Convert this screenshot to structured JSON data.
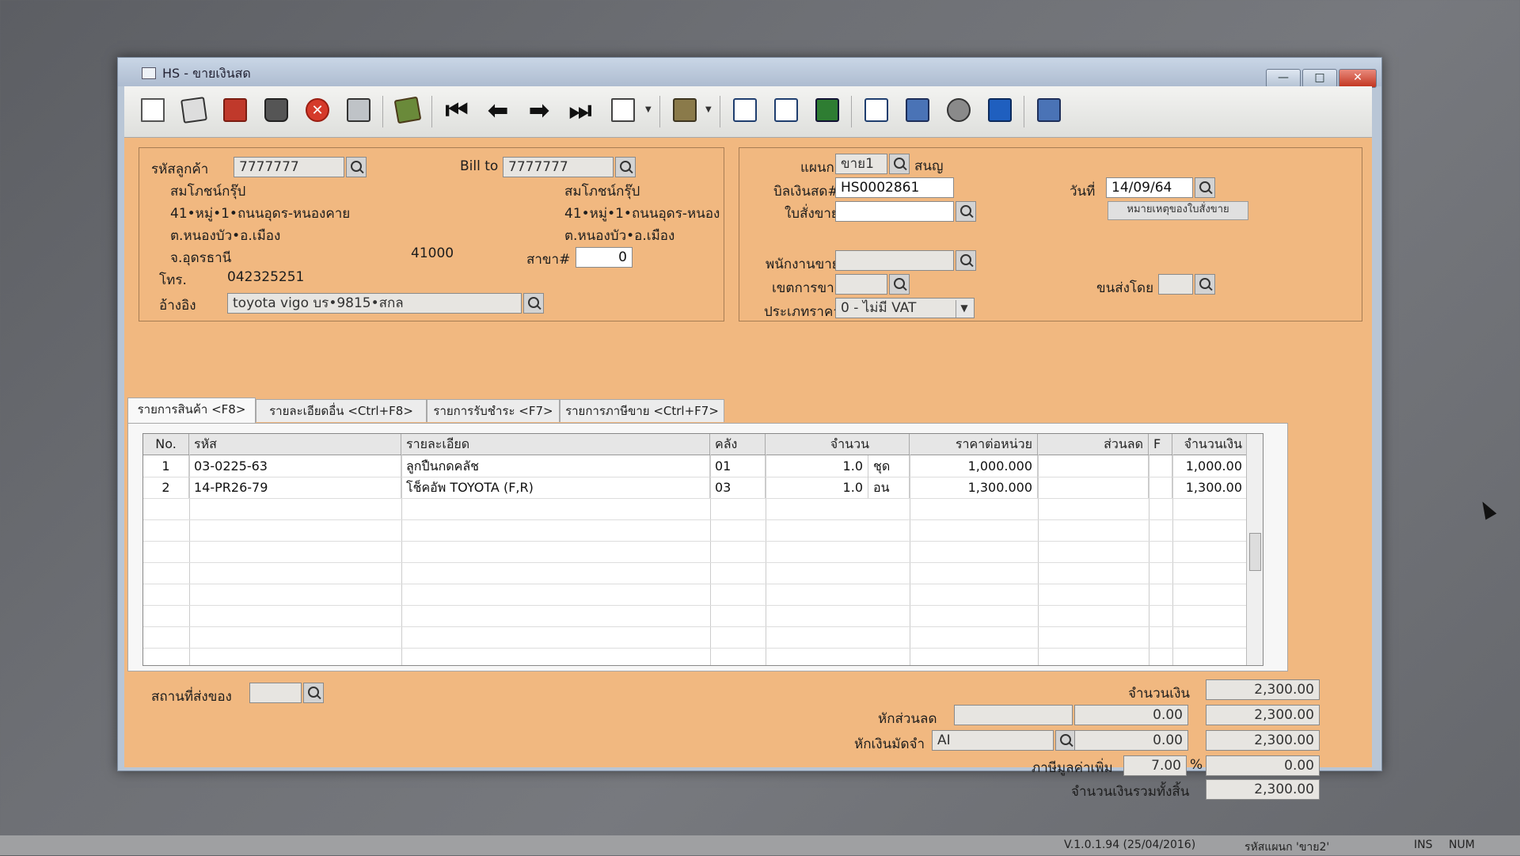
{
  "window": {
    "title": "HS - ขายเงินสด",
    "controls": {
      "minimize": "—",
      "maximize": "□",
      "close": "✕"
    }
  },
  "toolbar": {
    "icons": [
      "new-document-icon",
      "edit-icon",
      "void-icon",
      "delete-bin-icon",
      "cancel-icon",
      "save-icon",
      "book-icon",
      "first-record-icon",
      "previous-record-icon",
      "next-record-icon",
      "last-record-icon",
      "find-icon",
      "print-icon",
      "calculator-icon",
      "report-icon",
      "sales-order-icon",
      "calendar-icon",
      "approve-icon",
      "link-icon",
      "ok-document-icon",
      "network-icon"
    ],
    "nav_glyphs": {
      "first": "⏮",
      "prev": "⬅",
      "next": "➡",
      "last": "⏭"
    }
  },
  "customer": {
    "code_label": "รหัสลูกค้า",
    "code": "7777777",
    "bill_to_label": "Bill to",
    "bill_to": "7777777",
    "name": "สมโภชน์กรุ๊ป",
    "address1": "41•หมู่•1•ถนนอุดร-หนองคาย",
    "address2": "ต.หนองบัว•อ.เมือง",
    "province": "จ.อุดรธานี",
    "zip": "41000",
    "bill_name": "สมโภชน์กรุ๊ป",
    "bill_address1": "41•หมู่•1•ถนนอุดร-หนอง",
    "bill_address2": "ต.หนองบัว•อ.เมือง",
    "branch_label": "สาขา#",
    "branch": "0",
    "phone_label": "โทร.",
    "phone": "042325251",
    "ref_label": "อ้างอิง",
    "ref": "toyota vigo บร•9815•สกล"
  },
  "doc": {
    "dept_label": "แผนก",
    "dept": "ขาย1",
    "dept_name": "สนญ",
    "bill_label": "บิลเงินสด#",
    "bill_no": "HS0002861",
    "order_label": "ใบสั่งขาย",
    "order": "",
    "date_label": "วันที่",
    "date": "14/09/64",
    "note_button": "หมายเหตุของใบสั่งขาย",
    "salesman_label": "พนักงานขาย",
    "salesman": "",
    "area_label": "เขตการขาย",
    "area": "",
    "ship_by_label": "ขนส่งโดย",
    "ship_by": "",
    "price_type_label": "ประเภทราคา",
    "price_type": "0 - ไม่มี VAT"
  },
  "tabs": [
    {
      "label": "รายการสินค้า <F8>"
    },
    {
      "label": "รายละเอียดอื่น <Ctrl+F8>"
    },
    {
      "label": "รายการรับชำระ <F7>"
    },
    {
      "label": "รายการภาษีขาย <Ctrl+F7>"
    }
  ],
  "grid": {
    "headers": {
      "no": "No.",
      "code": "รหัส",
      "desc": "รายละเอียด",
      "wh": "คลัง",
      "qty": "จำนวน",
      "price": "ราคาต่อหน่วย",
      "disc": "ส่วนลด",
      "f": "F",
      "amount": "จำนวนเงิน"
    },
    "rows": [
      {
        "no": "1",
        "code": "03-0225-63",
        "desc": "ลูกปืนกดคลัช",
        "wh": "01",
        "qty": "1.0",
        "unit": "ชุด",
        "price": "1,000.000",
        "disc": "",
        "f": "",
        "amount": "1,000.00"
      },
      {
        "no": "2",
        "code": "14-PR26-79",
        "desc": "โช็คอัพ TOYOTA (F,R)",
        "wh": "03",
        "qty": "1.0",
        "unit": "อน",
        "price": "1,300.000",
        "disc": "",
        "f": "",
        "amount": "1,300.00"
      }
    ]
  },
  "footer": {
    "ship_place_label": "สถานที่ส่งของ",
    "ship_place": "",
    "amount_label": "จำนวนเงิน",
    "amount": "2,300.00",
    "discount_label": "หักส่วนลด",
    "discount_text": "",
    "discount_value": "0.00",
    "after_discount": "2,300.00",
    "deposit_label": "หักเงินมัดจำ",
    "deposit_code": "AI",
    "deposit_value": "0.00",
    "after_deposit": "2,300.00",
    "vat_label": "ภาษีมูลค่าเพิ่ม",
    "vat_rate": "7.00",
    "vat_percent": "%",
    "vat_amount": "0.00",
    "total_label": "จำนวนเงินรวมทั้งสิ้น",
    "total": "2,300.00"
  },
  "statusbar": {
    "version": "V.1.0.1.94 (25/04/2016)",
    "user": "รหัสแผนก 'ขาย2'",
    "ins": "INS",
    "num": "NUM"
  }
}
